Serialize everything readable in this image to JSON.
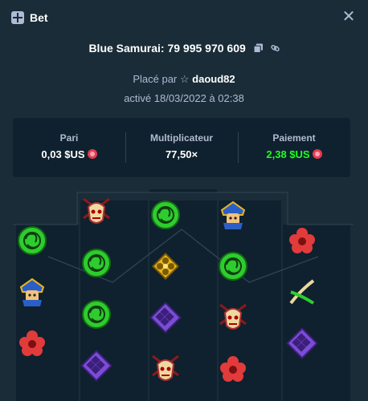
{
  "header": {
    "title": "Bet",
    "icon": "bet-icon",
    "close_icon": "close-icon"
  },
  "game": {
    "title": "Blue Samurai: 79 995 970 609",
    "copy_icon": "copy-icon",
    "link_icon": "link-icon"
  },
  "placed_by": {
    "prefix": "Placé par",
    "user": "daoud82",
    "icon": "star-icon"
  },
  "activated": "activé 18/03/2022 à 02:38",
  "stats": {
    "bet": {
      "label": "Pari",
      "value": "0,03 $US",
      "currency_icon": "coin-icon"
    },
    "multiplier": {
      "label": "Multiplicateur",
      "value": "77,50×"
    },
    "payout": {
      "label": "Paiement",
      "value": "2,38 $US",
      "currency_icon": "coin-icon"
    }
  },
  "reels": {
    "colors": {
      "reel_bg": "#0f212e",
      "reel_alt_bg": "#13293a",
      "page_bg": "#1a2c38",
      "green": "#2ecc2e",
      "gold": "#e6b422",
      "purple": "#7b4dd6",
      "red": "#e23b3b"
    },
    "columns": [
      {
        "name": "reel-1",
        "symbols": [
          "green-fan",
          "blue-samurai",
          "red-flower"
        ]
      },
      {
        "name": "reel-2",
        "symbols": [
          "red-mask",
          "green-fan",
          "green-fan",
          "purple-gem"
        ]
      },
      {
        "name": "reel-3",
        "symbols": [
          "green-fan",
          "gold-crest",
          "purple-gem",
          "red-mask"
        ]
      },
      {
        "name": "reel-4",
        "symbols": [
          "blue-samurai",
          "green-fan",
          "red-mask",
          "red-flower"
        ]
      },
      {
        "name": "reel-5",
        "symbols": [
          "red-flower",
          "crossed-swords",
          "purple-gem"
        ]
      }
    ]
  }
}
